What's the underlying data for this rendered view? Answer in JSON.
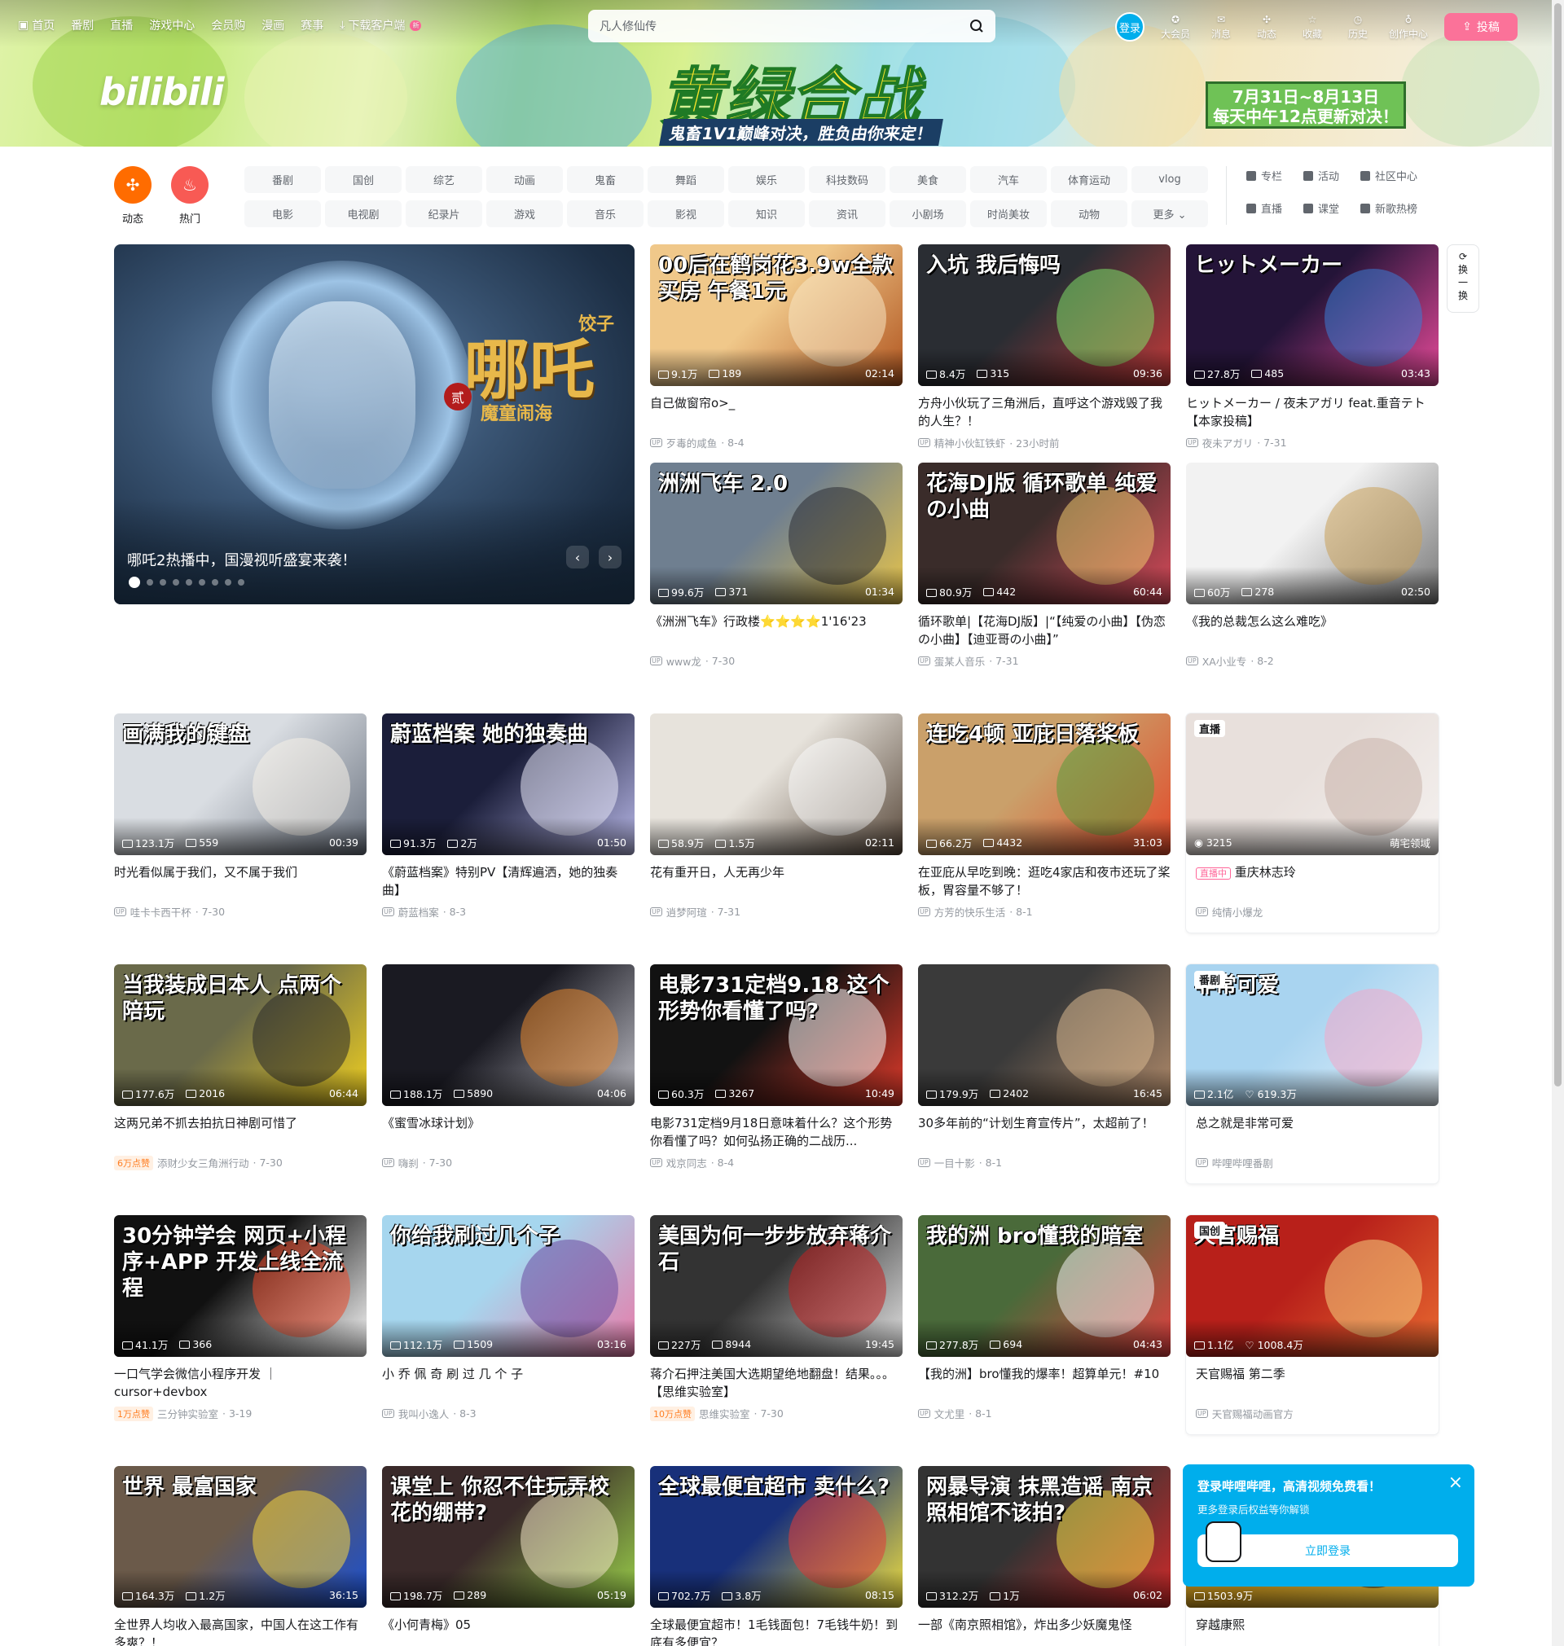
{
  "header": {
    "nav": [
      "首页",
      "番剧",
      "直播",
      "游戏中心",
      "会员购",
      "漫画",
      "赛事",
      "下载客户端"
    ],
    "new_badge": "新",
    "search_placeholder": "凡人修仙传",
    "login": "登录",
    "right": [
      "大会员",
      "消息",
      "动态",
      "收藏",
      "历史",
      "创作中心"
    ],
    "upload": "投稿",
    "logo": "bilibili",
    "banner_title": "黄绿合战",
    "banner_sub": "鬼畜1V1巅峰对决，胜负由你来定！",
    "banner_date1": "7月31日~8月13日",
    "banner_date2": "每天中午12点更新对决！"
  },
  "channels": {
    "dynamic": "动态",
    "hot": "热门",
    "tags": [
      "番剧",
      "国创",
      "综艺",
      "动画",
      "鬼畜",
      "舞蹈",
      "娱乐",
      "科技数码",
      "美食",
      "汽车",
      "体育运动",
      "vlog",
      "电影",
      "电视剧",
      "纪录片",
      "游戏",
      "音乐",
      "影视",
      "知识",
      "资讯",
      "小剧场",
      "时尚美妆",
      "动物",
      "更多"
    ],
    "links": [
      "专栏",
      "活动",
      "社区中心",
      "直播",
      "课堂",
      "新歌热榜"
    ]
  },
  "carousel": {
    "title": "哪吒2热播中，国漫视听盛宴来袭！",
    "logo": "哪吒",
    "logo_sub": "魔童闹海",
    "logo_side": "饺子",
    "logo_tag": "贰"
  },
  "refresh": "换一换",
  "videos": [
    {
      "cover": "00后在鹤岗花3.9w全款买房 午餐1元",
      "views": "9.1万",
      "dm": "189",
      "dur": "02:14",
      "title": "自己做窗帘o>_",
      "author": "歹毒的咸鱼",
      "date": "8-4"
    },
    {
      "cover": "入坑 我后悔吗",
      "views": "8.4万",
      "dm": "315",
      "dur": "09:36",
      "title": "方舟小伙玩了三角洲后，直呼这个游戏毁了我的人生？！",
      "author": "精神小伙缸铁虾",
      "date": "23小时前"
    },
    {
      "cover": "ヒットメーカー",
      "views": "27.8万",
      "dm": "485",
      "dur": "03:43",
      "title": "ヒットメーカー / 夜未アガリ feat.重音テト【本家投稿】",
      "author": "夜未アガリ",
      "date": "7-31"
    },
    {
      "cover": "洲洲飞车 2.0",
      "views": "99.6万",
      "dm": "371",
      "dur": "01:34",
      "title": "《洲洲飞车》行政楼⭐⭐⭐⭐1'16'23",
      "author": "www龙",
      "date": "7-30"
    },
    {
      "cover": "花海DJ版 循环歌单 纯爱の小曲",
      "views": "80.9万",
      "dm": "442",
      "dur": "60:44",
      "title": "循环歌单|【花海DJ版】|“【纯爱の小曲】【伪恋の小曲】【迪亚哥の小曲】”",
      "author": "蛋某人音乐",
      "date": "7-31"
    },
    {
      "cover": "",
      "views": "60万",
      "dm": "278",
      "dur": "02:50",
      "title": "《我的总裁怎么这么难吃》",
      "author": "XA小业专",
      "date": "8-2"
    },
    {
      "cover": "画满我的键盘",
      "views": "123.1万",
      "dm": "559",
      "dur": "00:39",
      "title": "时光看似属于我们，又不属于我们",
      "author": "哇卡卡西干杯",
      "date": "7-30"
    },
    {
      "cover": "蔚蓝档案 她的独奏曲",
      "views": "91.3万",
      "dm": "2万",
      "dur": "01:50",
      "title": "《蔚蓝档案》特别PV【清辉遍洒，她的独奏曲】",
      "author": "蔚蓝档案",
      "date": "8-3"
    },
    {
      "cover": "",
      "views": "58.9万",
      "dm": "1.5万",
      "dur": "02:11",
      "title": "花有重开日，人无再少年",
      "author": "逍梦阿瑄",
      "date": "7-31"
    },
    {
      "cover": "连吃4顿 亚庇日落桨板",
      "views": "66.2万",
      "dm": "4432",
      "dur": "31:03",
      "title": "在亚庇从早吃到晚：逛吃4家店和夜市还玩了桨板，胃容量不够了！",
      "author": "方芳的快乐生活",
      "date": "8-1"
    },
    {
      "cover": "当我装成日本人 点两个陪玩",
      "views": "177.6万",
      "dm": "2016",
      "dur": "06:44",
      "title": "这两兄弟不抓去拍抗日神剧可惜了",
      "hot": "6万点赞",
      "author": "添财少女三角洲行动",
      "date": "7-30"
    },
    {
      "cover": "",
      "views": "188.1万",
      "dm": "5890",
      "dur": "04:06",
      "title": "《蜜雪冰球计划》",
      "author": "嗨刹",
      "date": "7-30"
    },
    {
      "cover": "电影731定档9.18 这个形势你看懂了吗?",
      "views": "60.3万",
      "dm": "3267",
      "dur": "10:49",
      "title": "电影731定档9月18日意味着什么？这个形势你看懂了吗？如何弘扬正确的二战历...",
      "author": "戏京同志",
      "date": "8-4"
    },
    {
      "cover": "",
      "views": "179.9万",
      "dm": "2402",
      "dur": "16:45",
      "title": "30多年前的“计划生育宣传片”，太超前了！",
      "author": "一目十影",
      "date": "8-1"
    },
    {
      "cover": "30分钟学会 网页+小程序+APP 开发上线全流程",
      "views": "41.1万",
      "dm": "366",
      "dur": "",
      "title": "一口气学会微信小程序开发 ｜cursor+devbox",
      "hot": "1万点赞",
      "author": "三分钟实验室",
      "date": "3-19"
    },
    {
      "cover": "你给我刷过几个子",
      "views": "112.1万",
      "dm": "1509",
      "dur": "03:16",
      "title": "小 乔 佩 奇 刷 过 几 个 子",
      "author": "我叫小逸人",
      "date": "8-3"
    },
    {
      "cover": "美国为何一步步放弃蒋介石",
      "views": "227万",
      "dm": "8944",
      "dur": "19:45",
      "title": "蒋介石押注美国大选期望绝地翻盘！结果。。。【思维实验室】",
      "hot": "10万点赞",
      "author": "思维实验室",
      "date": "7-30"
    },
    {
      "cover": "我的洲 bro懂我的暗室",
      "views": "277.8万",
      "dm": "694",
      "dur": "04:43",
      "title": "【我的洲】bro懂我的爆率！超算单元！#10",
      "author": "文尤里",
      "date": "8-1"
    },
    {
      "cover": "世界 最富国家",
      "views": "164.3万",
      "dm": "1.2万",
      "dur": "36:15",
      "title": "全世界人均收入最高国家，中国人在这工作有多爽？！",
      "author": "",
      "date": ""
    },
    {
      "cover": "课堂上 你忍不住玩弄校花的绷带?",
      "views": "198.7万",
      "dm": "289",
      "dur": "05:19",
      "title": "《小何青梅》05",
      "author": "",
      "date": ""
    },
    {
      "cover": "全球最便宜超市 卖什么?",
      "views": "702.7万",
      "dm": "3.8万",
      "dur": "08:15",
      "title": "全球最便宜超市！1毛钱面包！7毛钱牛奶！到底有多便宜？",
      "author": "",
      "date": ""
    },
    {
      "cover": "网暴导演 抹黑造谣 南京照相馆不该拍?",
      "views": "312.2万",
      "dm": "1万",
      "dur": "06:02",
      "title": "一部《南京照相馆》，炸出多少妖魔鬼怪",
      "author": "",
      "date": ""
    }
  ],
  "specials": [
    {
      "badge": "直播",
      "views": "3215",
      "right": "萌宅领域",
      "livetag": "直播中",
      "title": "重庆林志玲",
      "author": "纯情小爆龙"
    },
    {
      "badge": "番剧",
      "cover": "非常可爱",
      "views": "2.1亿",
      "likes": "619.3万",
      "title": "总之就是非常可爱",
      "author": "哔哩哔哩番剧"
    },
    {
      "badge": "国创",
      "cover": "天官赐福",
      "views": "1.1亿",
      "likes": "1008.4万",
      "title": "天官赐福 第二季",
      "author": "天官赐福动画官方"
    },
    {
      "views": "1503.9万",
      "title": "穿越康熙"
    }
  ],
  "popup": {
    "title": "登录哔哩哔哩，高清视频免费看！",
    "sub": "更多登录后权益等你解锁",
    "btn": "立即登录"
  }
}
